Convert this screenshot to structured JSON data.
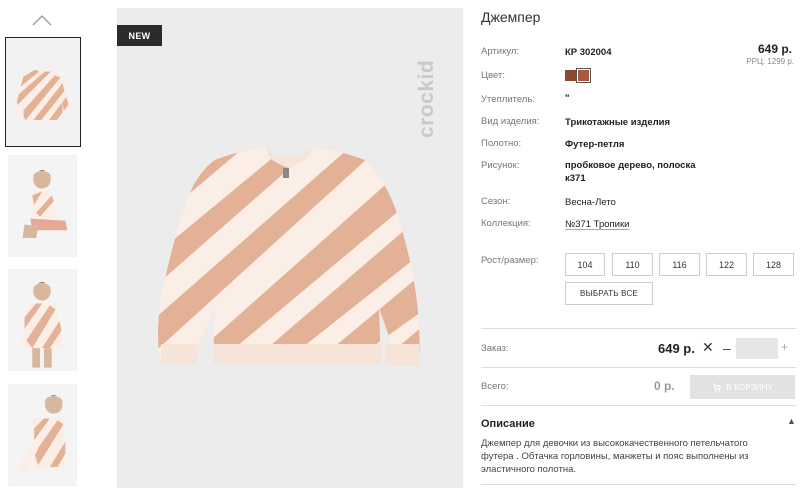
{
  "product": {
    "badge": "NEW",
    "brand": "crockid",
    "title": "Джемпер",
    "price": "649 р.",
    "rrc": "РРЦ: 1299 р."
  },
  "colors": {
    "swatch_1": "#8b4a32",
    "swatch_2": "#a85a40",
    "stripe_peach": "#e3b195",
    "stripe_cream": "#fbeee6"
  },
  "attributes": [
    {
      "label": "Артикул:",
      "value": "КР 302004"
    },
    {
      "label": "Цвет:",
      "value": ""
    },
    {
      "label": "Утеплитель:",
      "value": "\""
    },
    {
      "label": "Вид изделия:",
      "value": "Трикотажные изделия"
    },
    {
      "label": "Полотно:",
      "value": "Футер-петля"
    },
    {
      "label": "Рисунок:",
      "value": "пробковое дерево, полоска к371"
    },
    {
      "label": "Сезон:",
      "value": "Весна-Лето"
    },
    {
      "label": "Коллекция:",
      "value": "№371 Тропики"
    }
  ],
  "sizes": {
    "label": "Рост/размер:",
    "options": [
      "104",
      "110",
      "116",
      "122",
      "128"
    ],
    "select_all": "ВЫБРАТЬ ВСЕ"
  },
  "order": {
    "label": "Заказ:",
    "price": "649 р.",
    "multiply": "✕",
    "minus": "–",
    "plus": "+",
    "quantity": ""
  },
  "total": {
    "label": "Всего:",
    "value": "0 р.",
    "cart_button": "В КОРЗИНУ"
  },
  "description": {
    "title": "Описание",
    "toggle": "▲",
    "text": "Джемпер для девочки из высококачественного петельчатого футера . Обтачка горловины, манжеты и пояс выполнены из эластичного полотна."
  },
  "icons": {
    "thumbs_up": "chevron-up-icon",
    "cart": "cart-icon"
  }
}
